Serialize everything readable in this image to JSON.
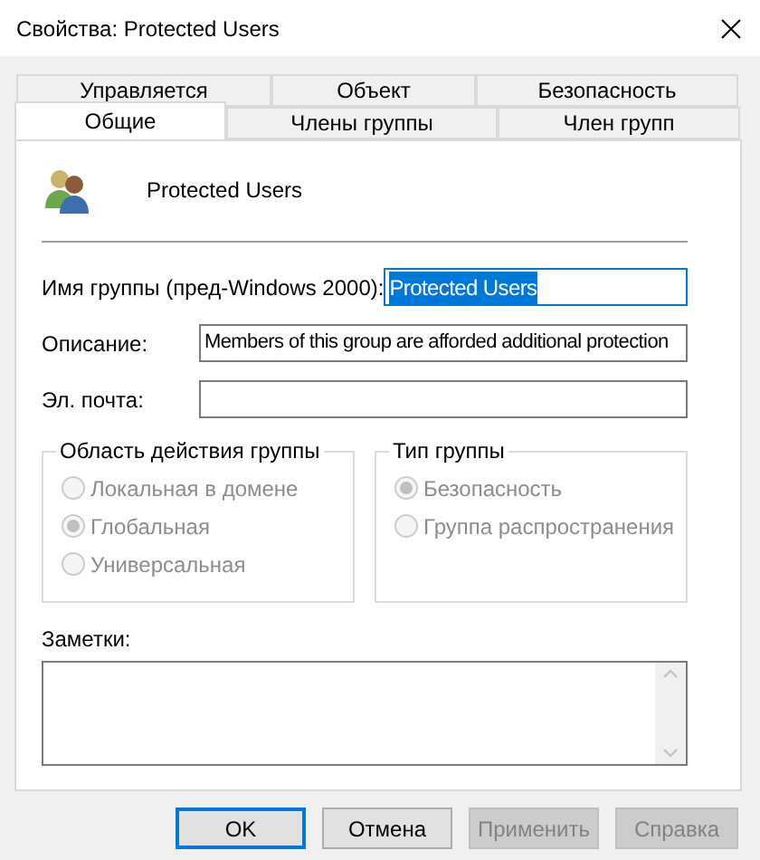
{
  "window": {
    "title": "Свойства: Protected Users"
  },
  "tab_rows": [
    [
      {
        "label": "Управляется",
        "selected": false
      },
      {
        "label": "Объект",
        "selected": false
      },
      {
        "label": "Безопасность",
        "selected": false
      }
    ],
    [
      {
        "label": "Общие",
        "selected": true
      },
      {
        "label": "Члены группы",
        "selected": false
      },
      {
        "label": "Член групп",
        "selected": false
      }
    ]
  ],
  "group_name": "Protected Users",
  "fields": [
    {
      "label": "Имя группы (пред-Windows 2000):",
      "value": "Protected Users",
      "highlighted": true
    },
    {
      "label": "Описание:",
      "value": "Members of this group are afforded additional protection",
      "highlighted": false
    },
    {
      "label": "Эл. почта:",
      "highlighted": false
    }
  ],
  "group_boxes": [
    {
      "title": "Область действия группы",
      "options": [
        {
          "label": "Локальная в домене",
          "selected": false,
          "disabled": true
        },
        {
          "label": "Глобальная",
          "selected": true,
          "disabled": true
        },
        {
          "label": "Универсальная",
          "selected": false,
          "disabled": true
        }
      ]
    },
    {
      "title": "Тип группы",
      "options": [
        {
          "label": "Безопасность",
          "selected": true,
          "disabled": true
        },
        {
          "label": "Группа распространения",
          "selected": false,
          "disabled": true
        }
      ]
    }
  ],
  "notes": {
    "label": "Заметки:"
  },
  "buttons": [
    {
      "label": "OK",
      "default": true,
      "disabled": false
    },
    {
      "label": "Отмена",
      "default": false,
      "disabled": false
    },
    {
      "label": "Применить",
      "default": false,
      "disabled": true
    },
    {
      "label": "Справка",
      "default": false,
      "disabled": true
    }
  ]
}
